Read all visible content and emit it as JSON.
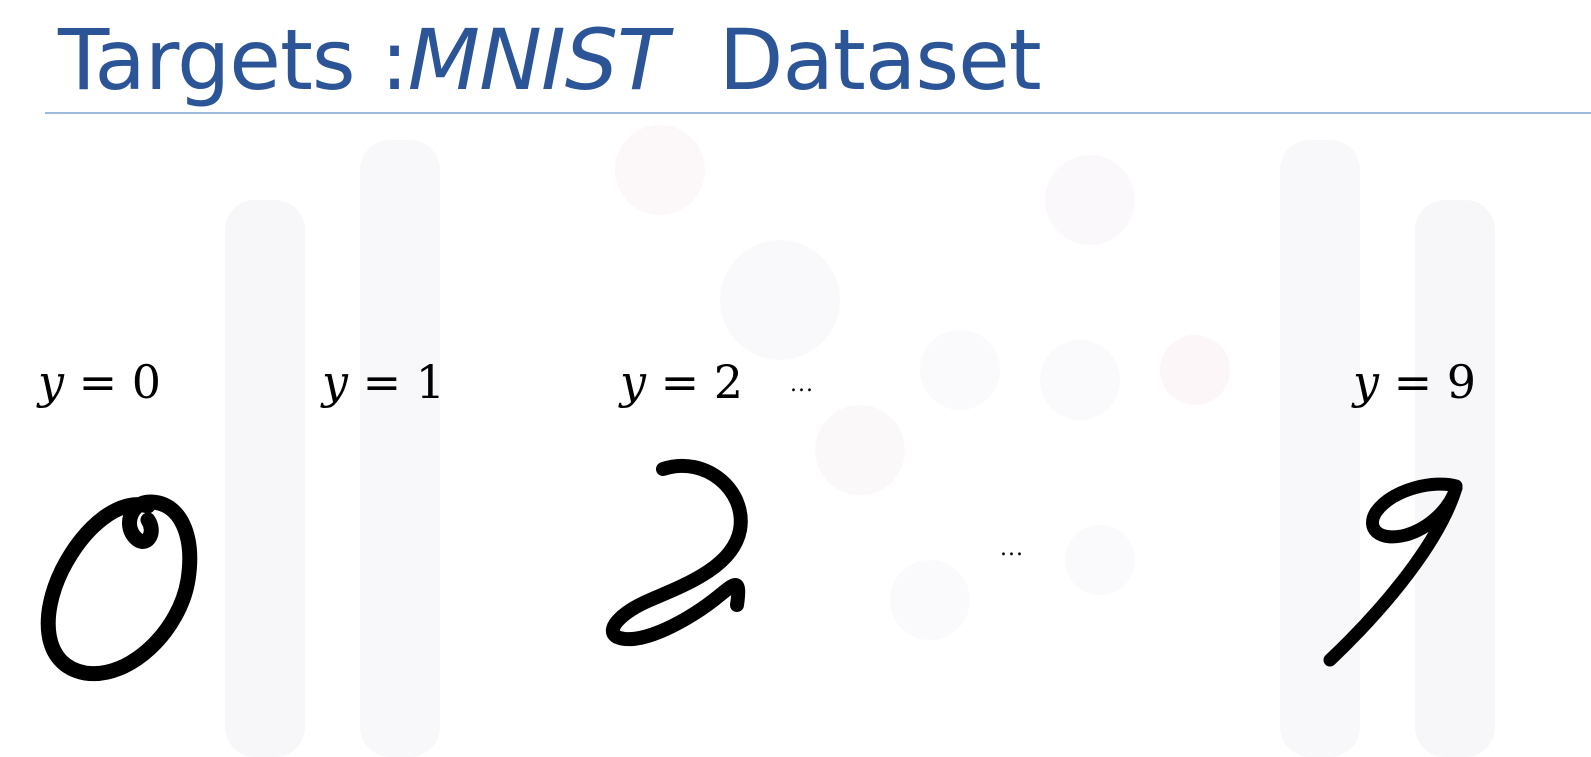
{
  "slide": {
    "title_prefix": "Targets :",
    "title_italic": "MNIST",
    "title_suffix": "Dataset"
  },
  "targets": [
    {
      "var": "y",
      "eq": " = ",
      "value": "0"
    },
    {
      "var": "y",
      "eq": " = ",
      "value": "1"
    },
    {
      "var": "y",
      "eq": " = ",
      "value": "2"
    },
    {
      "var": "y",
      "eq": " = ",
      "value": "9"
    }
  ],
  "ellipsis_top": "...",
  "ellipsis_middle": "...",
  "colors": {
    "title": "#2c5597",
    "rule": "#9db8dd",
    "ink": "#000000"
  }
}
